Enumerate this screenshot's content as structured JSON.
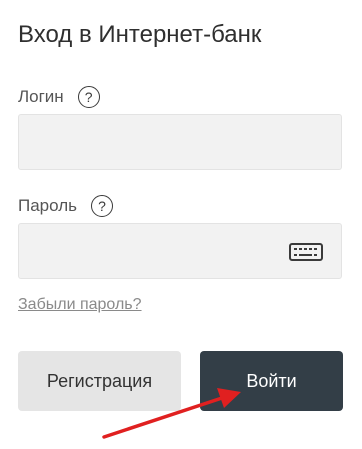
{
  "page": {
    "title": "Вход в Интернет-банк"
  },
  "login": {
    "label": "Логин",
    "help_symbol": "?",
    "value": "",
    "placeholder": ""
  },
  "password": {
    "label": "Пароль",
    "help_symbol": "?",
    "value": "",
    "placeholder": "",
    "keyboard_icon": "virtual-keyboard-icon"
  },
  "links": {
    "forgot_password": "Забыли пароль?"
  },
  "buttons": {
    "register": "Регистрация",
    "login": "Войти"
  },
  "annotation": {
    "arrow_color": "#e02020"
  },
  "colors": {
    "primary_button": "#333e47",
    "secondary_button": "#e5e5e5",
    "input_background": "#f2f2f2",
    "link": "#8a8a8a"
  }
}
